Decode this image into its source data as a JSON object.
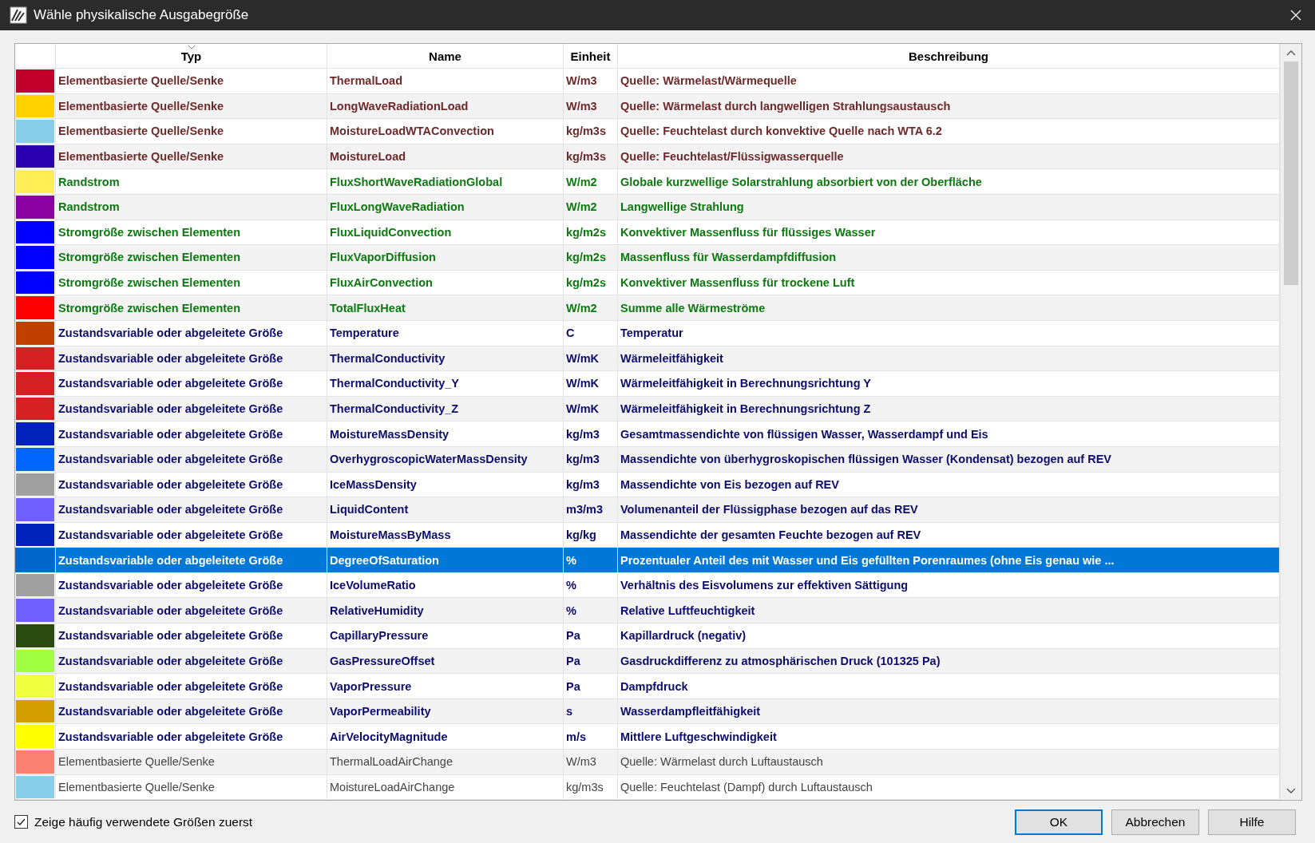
{
  "window": {
    "title": "Wähle physikalische Ausgabegröße"
  },
  "table": {
    "columns": [
      {
        "label": "Typ",
        "sorted": true
      },
      {
        "label": "Name",
        "sorted": false
      },
      {
        "label": "Einheit",
        "sorted": false
      },
      {
        "label": "Beschreibung",
        "sorted": false
      }
    ],
    "rows": [
      {
        "color": "#c0002a",
        "kind": "source",
        "type": "Elementbasierte Quelle/Senke",
        "name": "ThermalLoad",
        "unit": "W/m3",
        "description": "Quelle: Wärmelast/Wärmequelle",
        "selected": false
      },
      {
        "color": "#ffd200",
        "kind": "source",
        "type": "Elementbasierte Quelle/Senke",
        "name": "LongWaveRadiationLoad",
        "unit": "W/m3",
        "description": "Quelle: Wärmelast durch langwelligen Strahlungsaustausch",
        "selected": false
      },
      {
        "color": "#87ceeb",
        "kind": "source",
        "type": "Elementbasierte Quelle/Senke",
        "name": "MoistureLoadWTAConvection",
        "unit": "kg/m3s",
        "description": "Quelle: Feuchtelast durch konvektive Quelle nach WTA 6.2",
        "selected": false
      },
      {
        "color": "#2a00b0",
        "kind": "source",
        "type": "Elementbasierte Quelle/Senke",
        "name": "MoistureLoad",
        "unit": "kg/m3s",
        "description": "Quelle: Feuchtelast/Flüssigwasserquelle",
        "selected": false
      },
      {
        "color": "#ffee55",
        "kind": "flux",
        "type": "Randstrom",
        "name": "FluxShortWaveRadiationGlobal",
        "unit": "W/m2",
        "description": "Globale kurzwellige Solarstrahlung absorbiert von der Oberfläche",
        "selected": false
      },
      {
        "color": "#8b00a0",
        "kind": "flux",
        "type": "Randstrom",
        "name": "FluxLongWaveRadiation",
        "unit": "W/m2",
        "description": "Langwellige Strahlung",
        "selected": false
      },
      {
        "color": "#0000ff",
        "kind": "flux",
        "type": "Stromgröße zwischen Elementen",
        "name": "FluxLiquidConvection",
        "unit": "kg/m2s",
        "description": "Konvektiver Massenfluss für flüssiges Wasser",
        "selected": false
      },
      {
        "color": "#0000ff",
        "kind": "flux",
        "type": "Stromgröße zwischen Elementen",
        "name": "FluxVaporDiffusion",
        "unit": "kg/m2s",
        "description": "Massenfluss für Wasserdampfdiffusion",
        "selected": false
      },
      {
        "color": "#0000ff",
        "kind": "flux",
        "type": "Stromgröße zwischen Elementen",
        "name": "FluxAirConvection",
        "unit": "kg/m2s",
        "description": "Konvektiver Massenfluss für trockene Luft",
        "selected": false
      },
      {
        "color": "#ff0000",
        "kind": "flux",
        "type": "Stromgröße zwischen Elementen",
        "name": "TotalFluxHeat",
        "unit": "W/m2",
        "description": "Summe alle Wärmeströme",
        "selected": false
      },
      {
        "color": "#c04000",
        "kind": "state",
        "type": "Zustandsvariable oder abgeleitete Größe",
        "name": "Temperature",
        "unit": "C",
        "description": "Temperatur",
        "selected": false
      },
      {
        "color": "#d42020",
        "kind": "state",
        "type": "Zustandsvariable oder abgeleitete Größe",
        "name": "ThermalConductivity",
        "unit": "W/mK",
        "description": "Wärmeleitfähigkeit",
        "selected": false
      },
      {
        "color": "#d42020",
        "kind": "state",
        "type": "Zustandsvariable oder abgeleitete Größe",
        "name": "ThermalConductivity_Y",
        "unit": "W/mK",
        "description": "Wärmeleitfähigkeit in Berechnungsrichtung Y",
        "selected": false
      },
      {
        "color": "#d42020",
        "kind": "state",
        "type": "Zustandsvariable oder abgeleitete Größe",
        "name": "ThermalConductivity_Z",
        "unit": "W/mK",
        "description": "Wärmeleitfähigkeit in Berechnungsrichtung Z",
        "selected": false
      },
      {
        "color": "#0022bb",
        "kind": "state",
        "type": "Zustandsvariable oder abgeleitete Größe",
        "name": "MoistureMassDensity",
        "unit": "kg/m3",
        "description": "Gesamtmassendichte von flüssigen Wasser, Wasserdampf und Eis",
        "selected": false
      },
      {
        "color": "#0066ff",
        "kind": "state",
        "type": "Zustandsvariable oder abgeleitete Größe",
        "name": "OverhygroscopicWaterMassDensity",
        "unit": "kg/m3",
        "description": "Massendichte von überhygroskopischen flüssigen Wasser (Kondensat) bezogen auf REV",
        "selected": false
      },
      {
        "color": "#a0a0a0",
        "kind": "state",
        "type": "Zustandsvariable oder abgeleitete Größe",
        "name": "IceMassDensity",
        "unit": "kg/m3",
        "description": "Massendichte von Eis bezogen auf REV",
        "selected": false
      },
      {
        "color": "#7060ff",
        "kind": "state",
        "type": "Zustandsvariable oder abgeleitete Größe",
        "name": "LiquidContent",
        "unit": "m3/m3",
        "description": "Volumenanteil der Flüssigphase bezogen auf das REV",
        "selected": false
      },
      {
        "color": "#0022bb",
        "kind": "state",
        "type": "Zustandsvariable oder abgeleitete Größe",
        "name": "MoistureMassByMass",
        "unit": "kg/kg",
        "description": "Massendichte der gesamten Feuchte bezogen auf REV",
        "selected": false
      },
      {
        "color": "#0066cc",
        "kind": "state",
        "type": "Zustandsvariable oder abgeleitete Größe",
        "name": "DegreeOfSaturation",
        "unit": "%",
        "description": "Prozentualer Anteil des mit Wasser und Eis gefüllten Porenraumes (ohne Eis genau wie ...",
        "selected": true
      },
      {
        "color": "#a0a0a0",
        "kind": "state",
        "type": "Zustandsvariable oder abgeleitete Größe",
        "name": "IceVolumeRatio",
        "unit": "%",
        "description": "Verhältnis des Eisvolumens zur effektiven Sättigung",
        "selected": false
      },
      {
        "color": "#7060ff",
        "kind": "state",
        "type": "Zustandsvariable oder abgeleitete Größe",
        "name": "RelativeHumidity",
        "unit": "%",
        "description": "Relative Luftfeuchtigkeit",
        "selected": false
      },
      {
        "color": "#2a4a10",
        "kind": "state",
        "type": "Zustandsvariable oder abgeleitete Größe",
        "name": "CapillaryPressure",
        "unit": "Pa",
        "description": "Kapillardruck (negativ)",
        "selected": false
      },
      {
        "color": "#a0ff40",
        "kind": "state",
        "type": "Zustandsvariable oder abgeleitete Größe",
        "name": "GasPressureOffset",
        "unit": "Pa",
        "description": "Gasdruckdifferenz zu atmosphärischen Druck (101325 Pa)",
        "selected": false
      },
      {
        "color": "#f0ff40",
        "kind": "state",
        "type": "Zustandsvariable oder abgeleitete Größe",
        "name": "VaporPressure",
        "unit": "Pa",
        "description": "Dampfdruck",
        "selected": false
      },
      {
        "color": "#d4a000",
        "kind": "state",
        "type": "Zustandsvariable oder abgeleitete Größe",
        "name": "VaporPermeability",
        "unit": "s",
        "description": "Wasserdampfleitfähigkeit",
        "selected": false
      },
      {
        "color": "#ffff00",
        "kind": "state",
        "type": "Zustandsvariable oder abgeleitete Größe",
        "name": "AirVelocityMagnitude",
        "unit": "m/s",
        "description": "Mittlere Luftgeschwindigkeit",
        "selected": false
      },
      {
        "color": "#fa8072",
        "kind": "plain",
        "type": "Elementbasierte Quelle/Senke",
        "name": "ThermalLoadAirChange",
        "unit": "W/m3",
        "description": "Quelle: Wärmelast durch Luftaustausch",
        "selected": false
      },
      {
        "color": "#87ceeb",
        "kind": "plain",
        "type": "Elementbasierte Quelle/Senke",
        "name": "MoistureLoadAirChange",
        "unit": "kg/m3s",
        "description": "Quelle: Feuchtelast (Dampf) durch Luftaustausch",
        "selected": false
      }
    ]
  },
  "footer": {
    "checkbox": {
      "label": "Zeige häufig verwendete Größen zuerst",
      "checked": true
    },
    "buttons": [
      {
        "label": "OK",
        "default": true
      },
      {
        "label": "Abbrechen",
        "default": false
      },
      {
        "label": "Hilfe",
        "default": false
      }
    ]
  }
}
